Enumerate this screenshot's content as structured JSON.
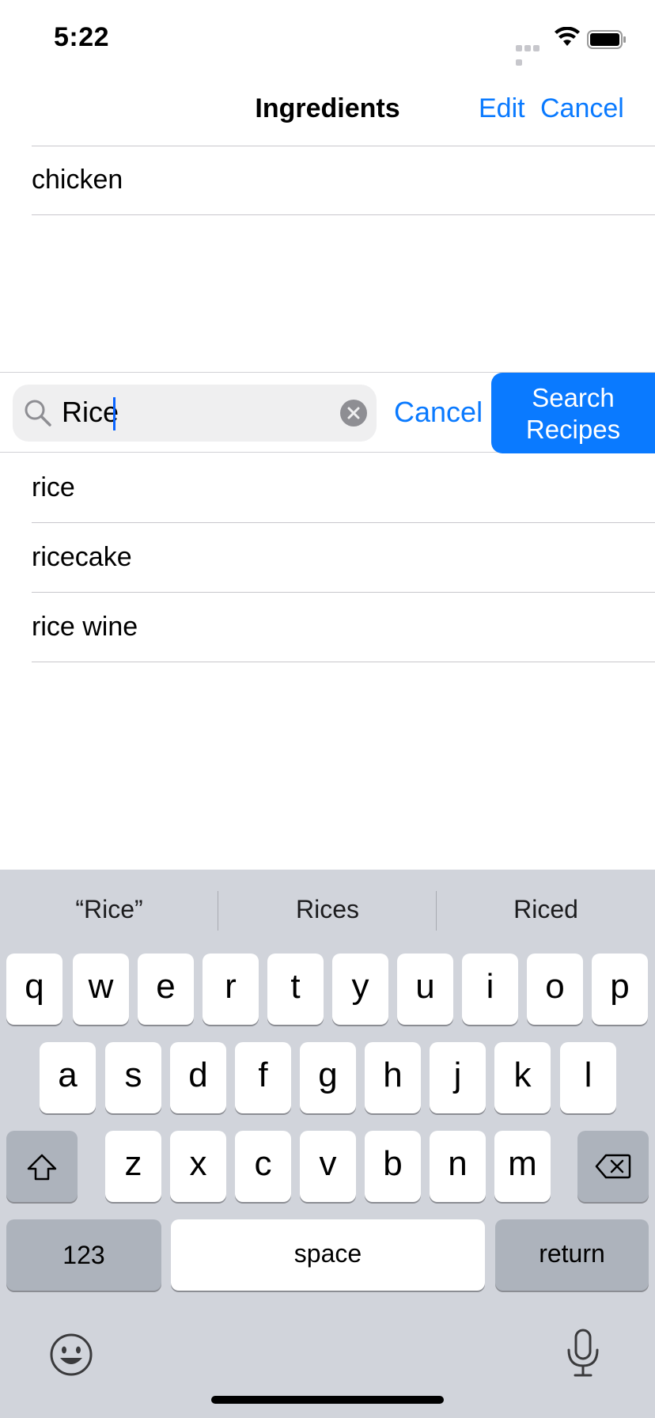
{
  "status": {
    "time": "5:22"
  },
  "nav": {
    "title": "Ingredients",
    "edit": "Edit",
    "cancel": "Cancel"
  },
  "selected_ingredients": [
    "chicken"
  ],
  "search": {
    "value": "Rice",
    "cancel": "Cancel",
    "button_line1": "Search",
    "button_line2": "Recipes"
  },
  "results": [
    "rice",
    "ricecake",
    "rice wine"
  ],
  "keyboard": {
    "suggestions": [
      "“Rice”",
      "Rices",
      "Riced"
    ],
    "row1": [
      "q",
      "w",
      "e",
      "r",
      "t",
      "y",
      "u",
      "i",
      "o",
      "p"
    ],
    "row2": [
      "a",
      "s",
      "d",
      "f",
      "g",
      "h",
      "j",
      "k",
      "l"
    ],
    "row3": [
      "z",
      "x",
      "c",
      "v",
      "b",
      "n",
      "m"
    ],
    "numbers": "123",
    "space": "space",
    "return": "return"
  },
  "colors": {
    "accent": "#0a7aff",
    "keyboard_bg": "#d1d4db"
  },
  "icons": [
    "search-icon",
    "clear-icon",
    "shift-icon",
    "backspace-icon",
    "emoji-icon",
    "microphone-icon",
    "wifi-icon",
    "battery-icon"
  ]
}
